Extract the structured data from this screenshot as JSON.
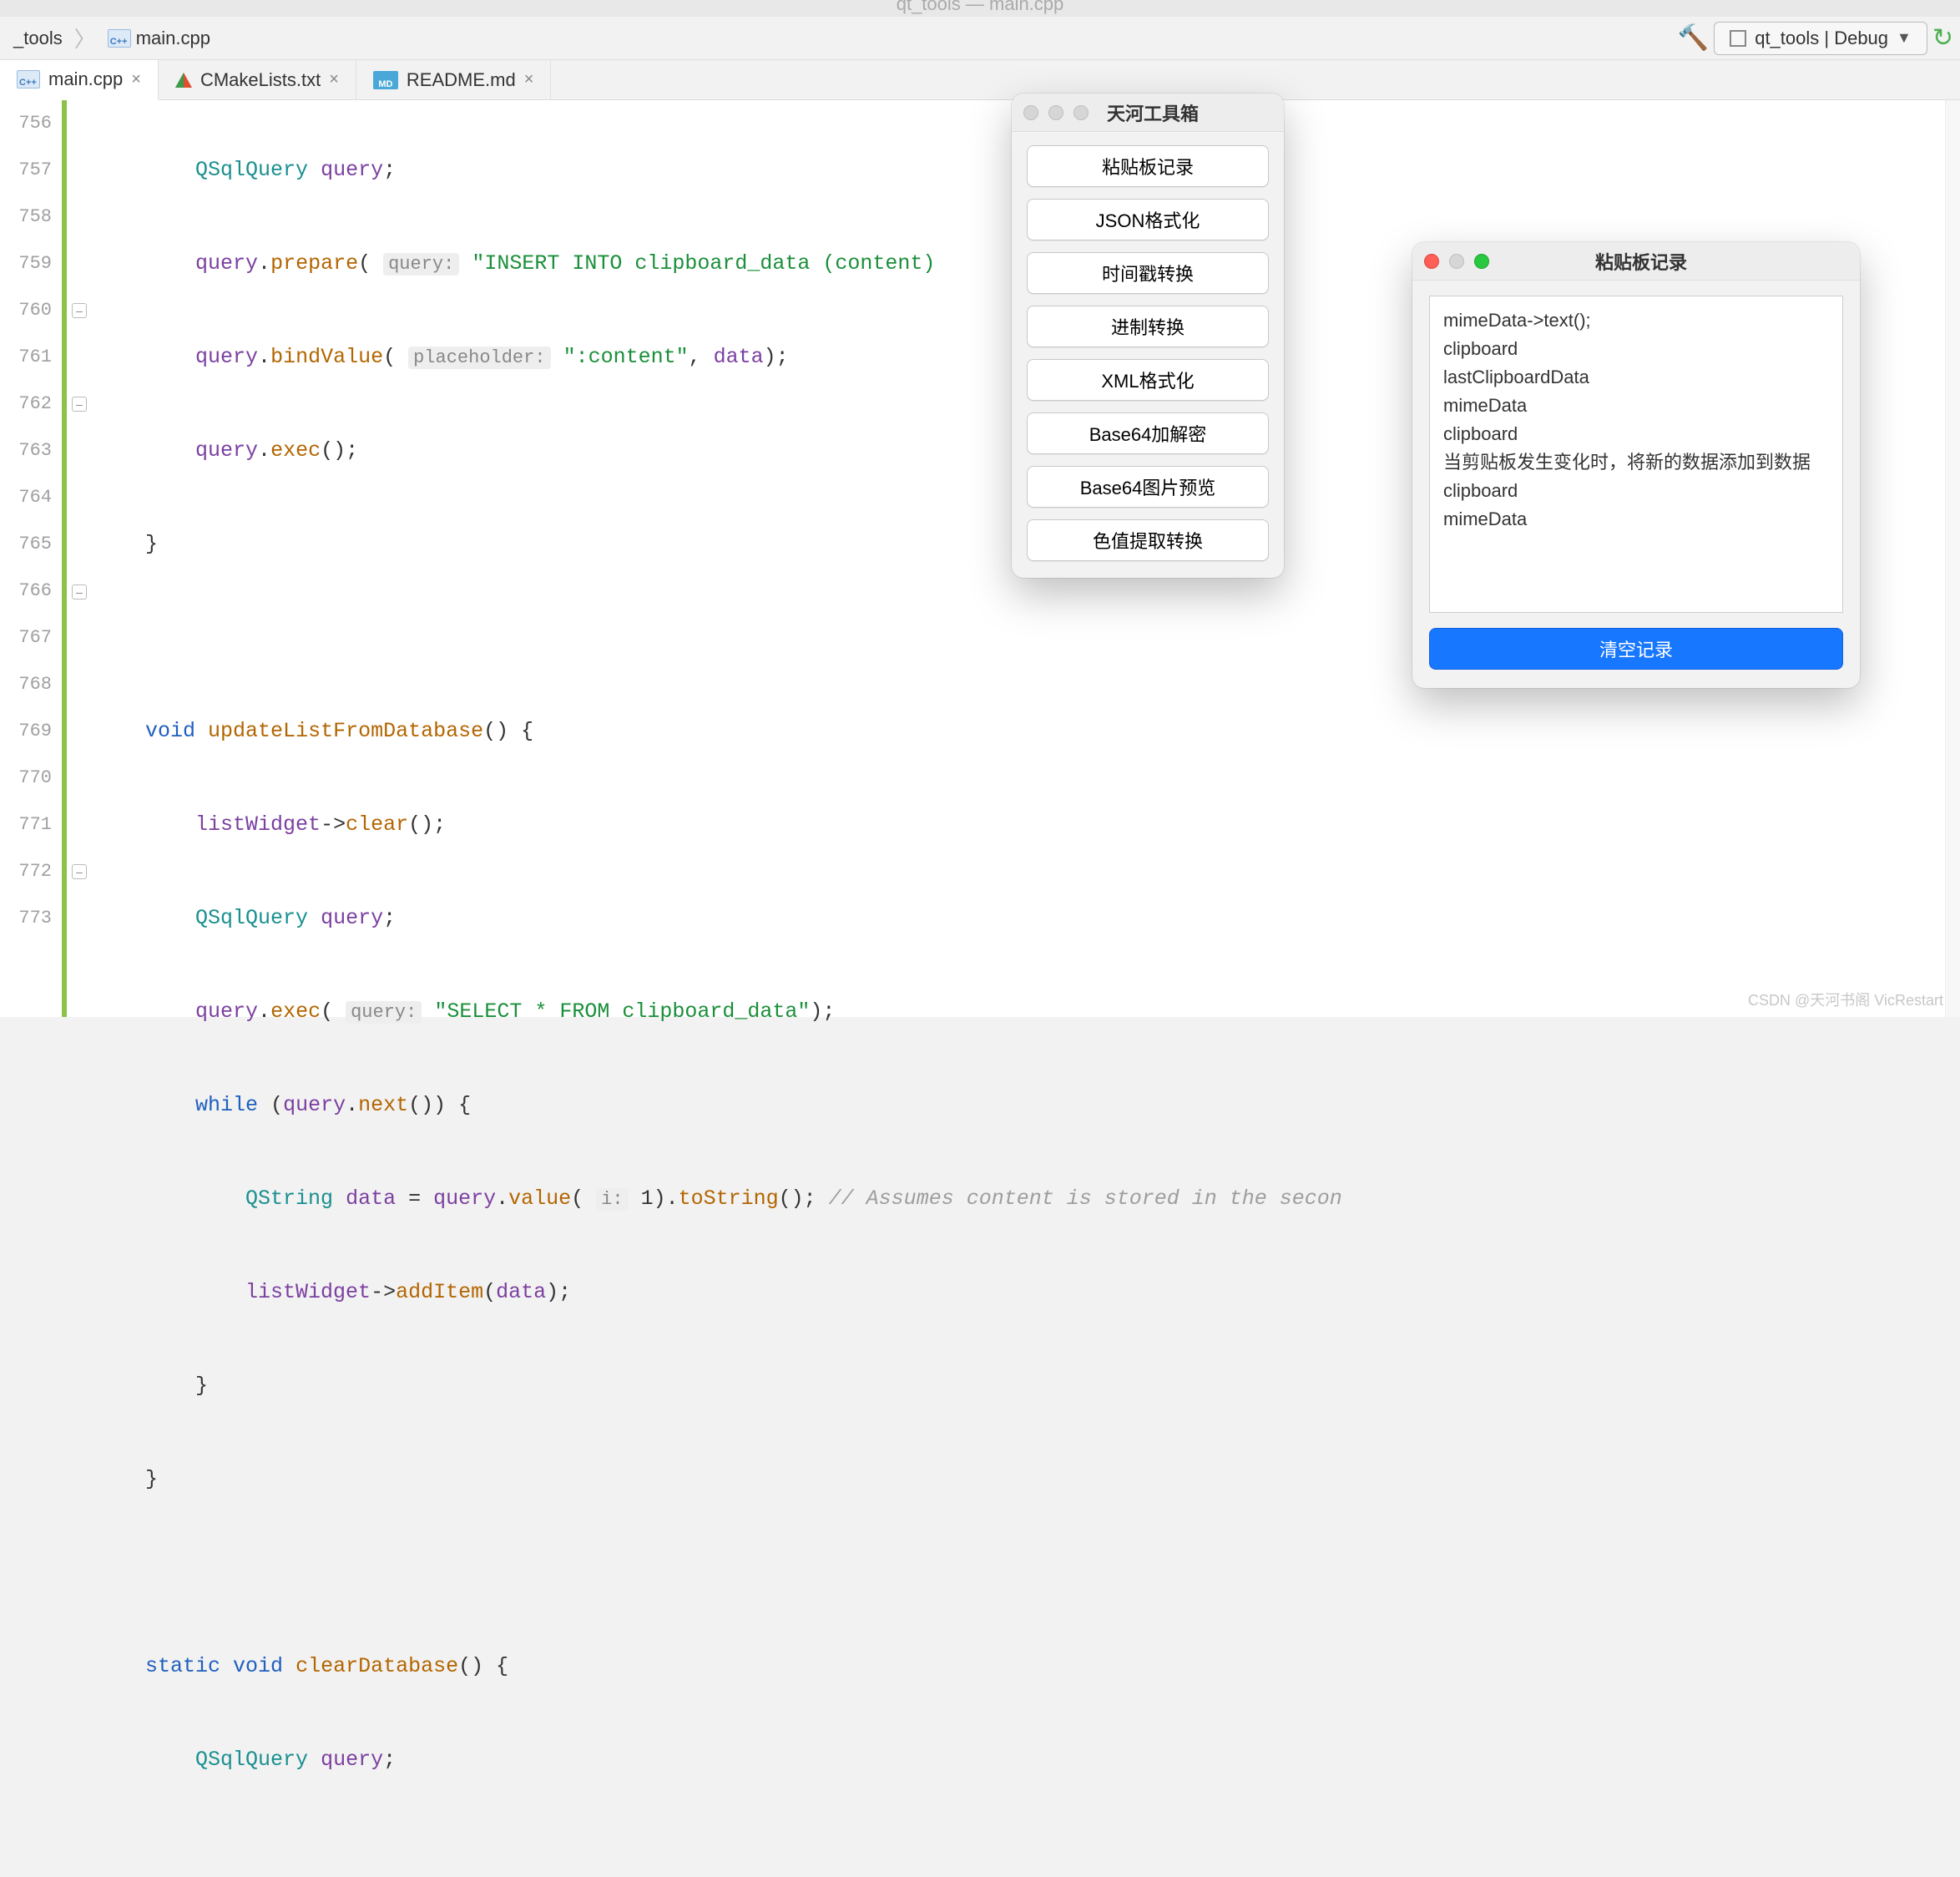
{
  "window_title": "qt_tools — main.cpp",
  "breadcrumb": {
    "project": "_tools",
    "file": "main.cpp"
  },
  "run_config": "qt_tools | Debug",
  "tabs": [
    {
      "label": "main.cpp",
      "icon": "cpp",
      "active": true
    },
    {
      "label": "CMakeLists.txt",
      "icon": "cmake",
      "active": false
    },
    {
      "label": "README.md",
      "icon": "md",
      "active": false
    }
  ],
  "gutter": {
    "start": 756,
    "count": 18
  },
  "code": {
    "l756": {
      "type": "QSqlQuery",
      "ident": "query"
    },
    "l757": {
      "ident": "query",
      "call": "prepare",
      "hint": "query:",
      "str": "\"INSERT INTO clipboard_data (content) "
    },
    "l758": {
      "ident": "query",
      "call": "bindValue",
      "hint": "placeholder:",
      "str": "\":content\"",
      "arg": "data"
    },
    "l759": {
      "ident": "query",
      "call": "exec"
    },
    "l762": {
      "kw": "void",
      "func": "updateListFromDatabase"
    },
    "l763": {
      "ident": "listWidget",
      "call": "clear"
    },
    "l764": {
      "type": "QSqlQuery",
      "ident": "query"
    },
    "l765": {
      "ident": "query",
      "call": "exec",
      "hint": "query:",
      "str": "\"SELECT * FROM clipboard_data\""
    },
    "l766": {
      "kw": "while",
      "ident": "query",
      "call": "next"
    },
    "l767": {
      "type": "QString",
      "ident": "data",
      "src": "query",
      "call": "value",
      "hint": "i:",
      "arg": "1",
      "call2": "toString",
      "comment": "// Assumes content is stored in the secon"
    },
    "l768": {
      "ident": "listWidget",
      "call": "addItem",
      "arg": "data"
    },
    "l772": {
      "kw1": "static",
      "kw2": "void",
      "func": "clearDatabase"
    },
    "l773": {
      "type": "QSqlQuery",
      "ident": "query"
    }
  },
  "toolbox": {
    "title": "天河工具箱",
    "buttons": [
      "粘贴板记录",
      "JSON格式化",
      "时间戳转换",
      "进制转换",
      "XML格式化",
      "Base64加解密",
      "Base64图片预览",
      "色值提取转换"
    ]
  },
  "clipboard_window": {
    "title": "粘贴板记录",
    "items": [
      "mimeData->text();",
      "clipboard",
      "lastClipboardData",
      "mimeData",
      "clipboard",
      "当剪贴板发生变化时，将新的数据添加到数据",
      "clipboard",
      "mimeData"
    ],
    "clear_label": "清空记录"
  },
  "watermark": "CSDN @天河书阁 VicRestart"
}
